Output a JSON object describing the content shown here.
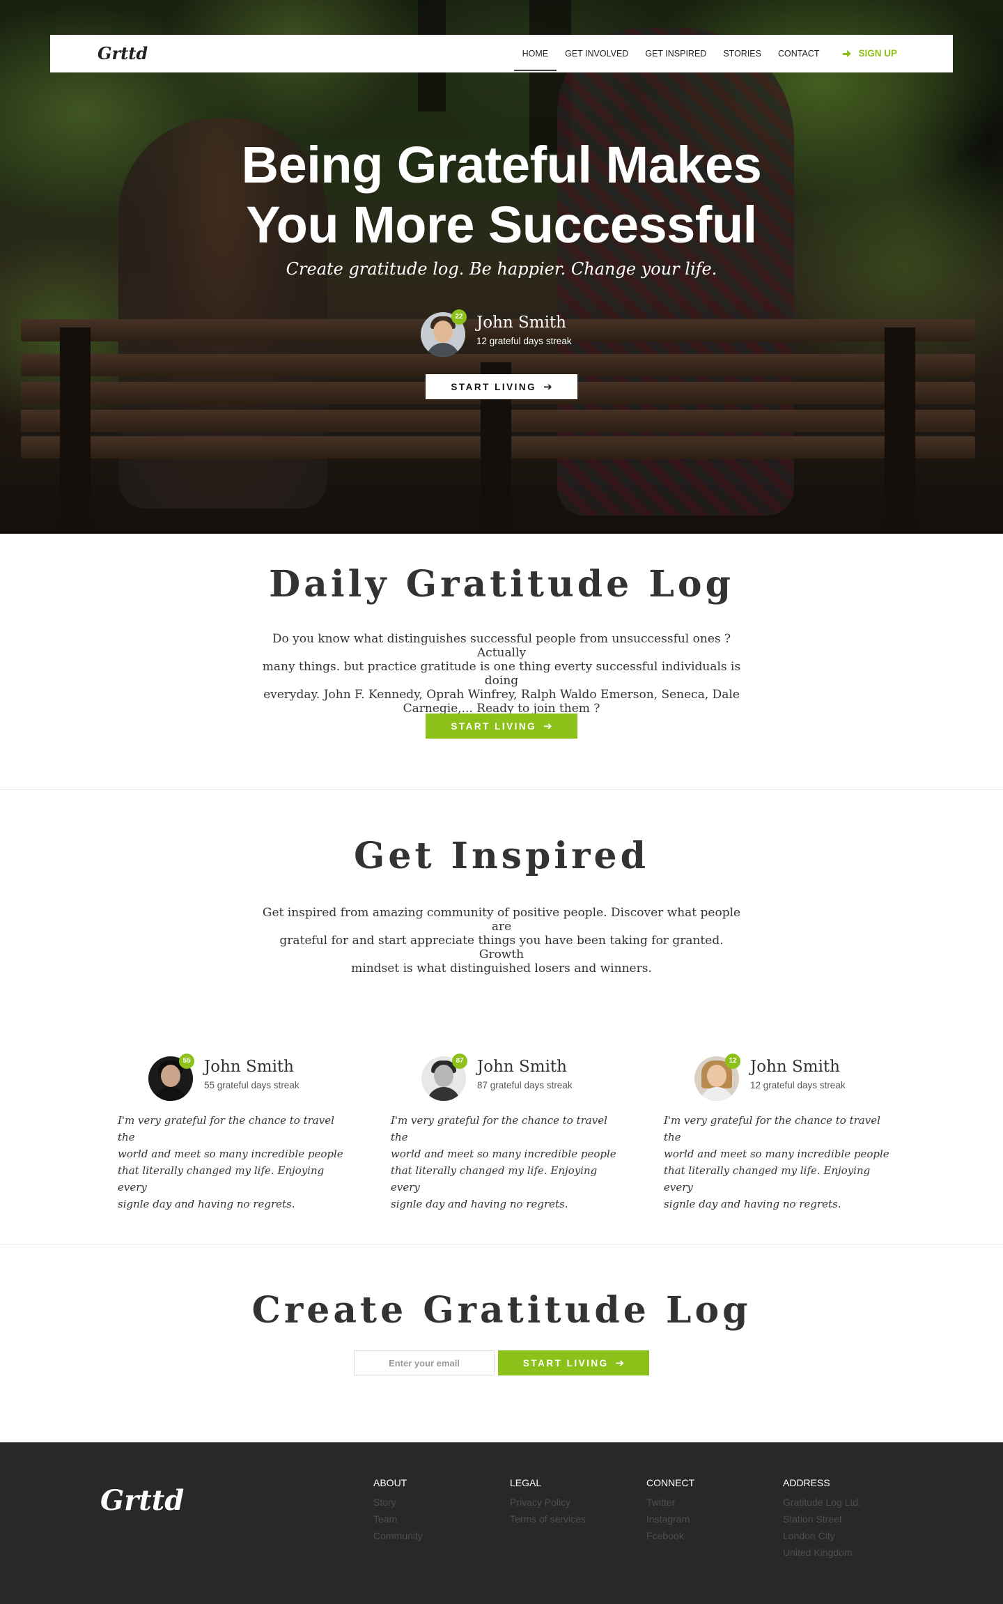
{
  "brand": {
    "logo": "Grttd",
    "accent_color": "#8cc11a"
  },
  "nav": {
    "items": [
      {
        "label": "HOME",
        "active": true
      },
      {
        "label": "GET INVOLVED"
      },
      {
        "label": "GET INSPIRED"
      },
      {
        "label": "STORIES"
      },
      {
        "label": "CONTACT"
      }
    ],
    "signup": {
      "label": "SIGN UP",
      "icon": "sign-in-icon"
    }
  },
  "hero": {
    "title_line1": "Being Grateful Makes",
    "title_line2": "You More Successful",
    "subtitle": "Create gratitude log. Be happier. Change your life.",
    "user": {
      "name": "John Smith",
      "streak_text": "12 grateful days streak",
      "badge": "22"
    },
    "cta": "START LIVING"
  },
  "daily": {
    "title": "Daily Gratitude Log",
    "line1": "Do you know what distinguishes successful people from unsuccessful ones ? Actually",
    "line2": "many things. but practice gratitude is one thing everty successful individuals is doing",
    "line3": "everyday. John F. Kennedy, Oprah Winfrey, Ralph Waldo Emerson, Seneca, Dale",
    "line4": "Carnegie,... Ready to join them ?",
    "cta": "START LIVING"
  },
  "inspired": {
    "title": "Get Inspired",
    "line1": "Get inspired from amazing community of positive people. Discover what people are",
    "line2": "grateful for and start appreciate things you have been taking for granted. Growth",
    "line3": "mindset is what distinguished losers and winners.",
    "testimonials": [
      {
        "name": "John Smith",
        "streak": "55 grateful days streak",
        "badge": "55",
        "q1": "I'm very grateful for the chance to travel the",
        "q2": "world and meet so many incredible people",
        "q3": "that literally changed my life. Enjoying every",
        "q4": "signle day and having no regrets."
      },
      {
        "name": "John Smith",
        "streak": "87 grateful days streak",
        "badge": "87",
        "q1": "I'm very grateful for the chance to travel the",
        "q2": "world and meet so many incredible people",
        "q3": "that literally changed my life. Enjoying every",
        "q4": "signle day and having no regrets."
      },
      {
        "name": "John Smith",
        "streak": "12 grateful days streak",
        "badge": "12",
        "q1": "I'm very grateful for the chance to travel the",
        "q2": "world and meet so many incredible people",
        "q3": "that literally changed my life. Enjoying every",
        "q4": "signle day and having no regrets."
      }
    ]
  },
  "create": {
    "title": "Create Gratitude Log",
    "email_placeholder": "Enter your email",
    "cta": "START LIVING"
  },
  "footer": {
    "logo": "Grttd",
    "columns": [
      {
        "heading": "ABOUT",
        "items": [
          "Story",
          "Team",
          "Community"
        ]
      },
      {
        "heading": "LEGAL",
        "items": [
          "Privacy Policy",
          "Terms of services"
        ]
      },
      {
        "heading": "CONNECT",
        "items": [
          "Twitter",
          "Instagram",
          "Fcebook"
        ]
      },
      {
        "heading": "ADDRESS",
        "items": [
          "Gratitude Log Ltd.",
          "Station Street",
          "London City",
          "United Kingdom"
        ]
      }
    ]
  }
}
